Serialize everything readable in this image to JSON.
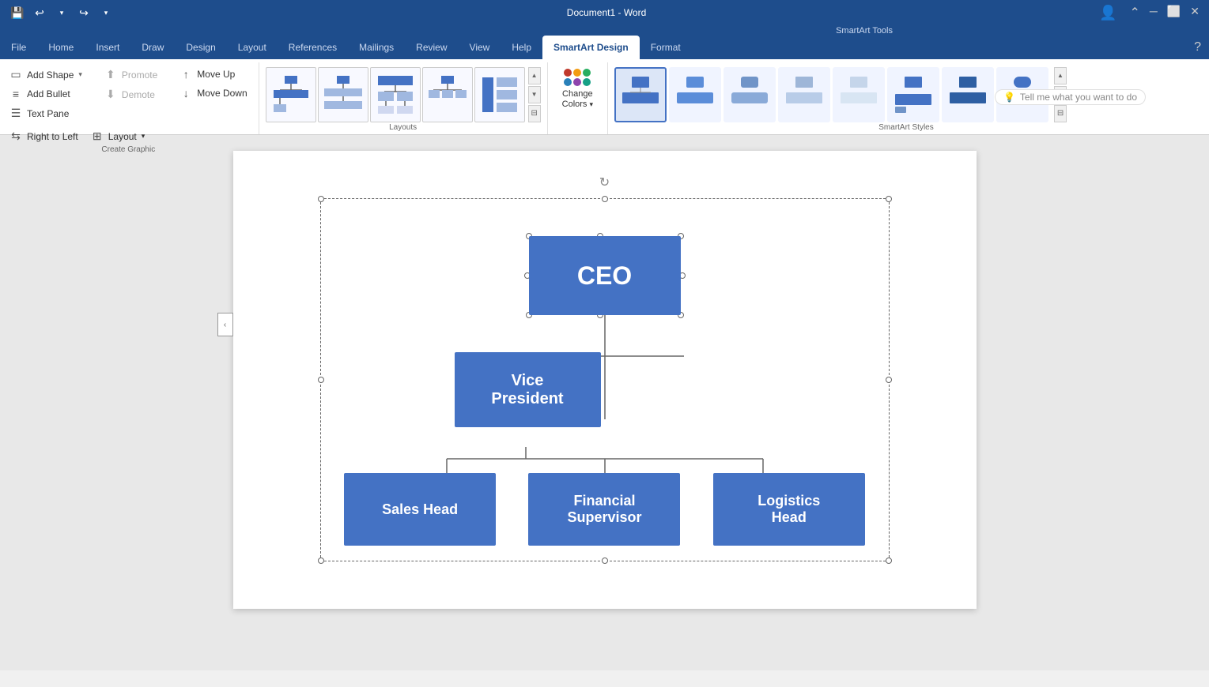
{
  "titleBar": {
    "title": "Document1 - Word",
    "qatIcons": [
      "save",
      "undo",
      "redo",
      "dropdown"
    ]
  },
  "smartartToolsLabel": "SmartArt Tools",
  "tabs": [
    {
      "id": "file",
      "label": "File"
    },
    {
      "id": "home",
      "label": "Home"
    },
    {
      "id": "insert",
      "label": "Insert"
    },
    {
      "id": "draw",
      "label": "Draw"
    },
    {
      "id": "design",
      "label": "Design"
    },
    {
      "id": "layout",
      "label": "Layout"
    },
    {
      "id": "references",
      "label": "References"
    },
    {
      "id": "mailings",
      "label": "Mailings"
    },
    {
      "id": "review",
      "label": "Review"
    },
    {
      "id": "view",
      "label": "View"
    },
    {
      "id": "help",
      "label": "Help"
    },
    {
      "id": "smartart-design",
      "label": "SmartArt Design",
      "active": true
    },
    {
      "id": "format",
      "label": "Format"
    }
  ],
  "ribbon": {
    "groups": [
      {
        "id": "create-graphic",
        "label": "Create Graphic",
        "buttons": [
          {
            "id": "add-shape",
            "label": "Add Shape",
            "icon": "▭",
            "hasDropdown": true
          },
          {
            "id": "add-bullet",
            "label": "Add Bullet",
            "icon": "≡",
            "disabled": false
          },
          {
            "id": "text-pane",
            "label": "Text Pane",
            "icon": "☰",
            "disabled": false
          },
          {
            "id": "promote",
            "label": "Promote",
            "icon": "←",
            "direction": "up"
          },
          {
            "id": "demote",
            "label": "Demote",
            "icon": "→",
            "direction": "down"
          },
          {
            "id": "move-up",
            "label": "Move Up",
            "icon": "↑"
          },
          {
            "id": "move-down",
            "label": "Move Down",
            "icon": "↓"
          },
          {
            "id": "right-to-left",
            "label": "Right to Left",
            "icon": "⇆"
          },
          {
            "id": "layout-btn",
            "label": "Layout",
            "icon": "⊞",
            "hasDropdown": true
          }
        ]
      },
      {
        "id": "layouts",
        "label": "Layouts"
      },
      {
        "id": "change-colors",
        "label": "Change Colors",
        "colors": [
          "#c0392b",
          "#f39c12",
          "#27ae60",
          "#2980b9",
          "#8e44ad",
          "#16a085"
        ]
      },
      {
        "id": "smartart-styles",
        "label": "SmartArt Styles"
      }
    ]
  },
  "tellMe": {
    "placeholder": "Tell me what you want to do",
    "icon": "lightbulb"
  },
  "diagram": {
    "nodes": [
      {
        "id": "ceo",
        "label": "CEO",
        "level": 0
      },
      {
        "id": "vp",
        "label": "Vice\nPresident",
        "level": 1
      },
      {
        "id": "sales",
        "label": "Sales Head",
        "level": 2
      },
      {
        "id": "financial",
        "label": "Financial\nSupervisor",
        "level": 2
      },
      {
        "id": "logistics",
        "label": "Logistics\nHead",
        "level": 2
      }
    ],
    "boxColor": "#4472c4",
    "textColor": "#ffffff"
  }
}
